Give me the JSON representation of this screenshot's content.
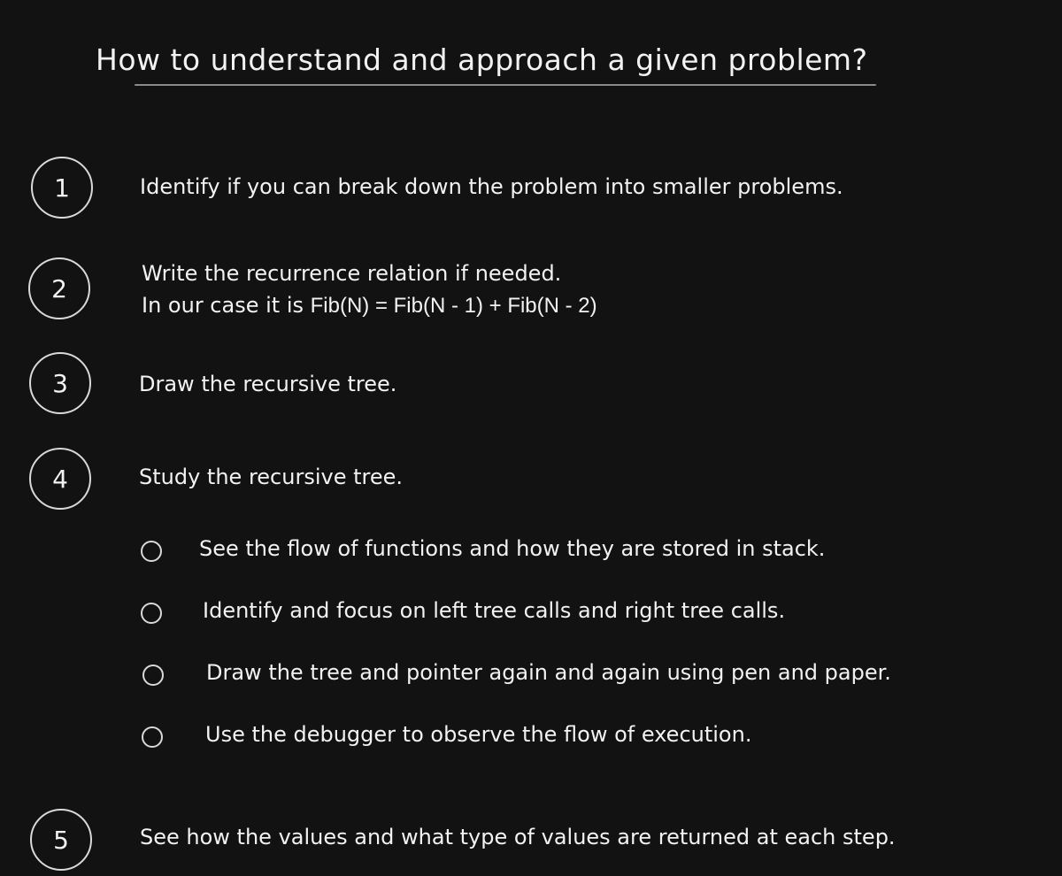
{
  "title": "How to understand and approach a given problem?",
  "steps": [
    {
      "number": "1",
      "text": "Identify if you can break down the problem into smaller problems."
    },
    {
      "number": "2",
      "line1": "Write the recurrence relation if needed.",
      "line2_prefix": "In our case it is ",
      "line2_formula": "Fib(N) = Fib(N - 1) + Fib(N - 2)"
    },
    {
      "number": "3",
      "text": "Draw the recursive tree."
    },
    {
      "number": "4",
      "text": "Study the recursive tree.",
      "bullets": [
        "See the flow of functions and how they are stored in stack.",
        "Identify and focus on left tree calls and right tree calls.",
        "Draw the tree and pointer again and again using pen and paper.",
        "Use the debugger to observe the flow of execution."
      ]
    },
    {
      "number": "5",
      "text": "See how the values and what type of values are returned at each step."
    }
  ]
}
